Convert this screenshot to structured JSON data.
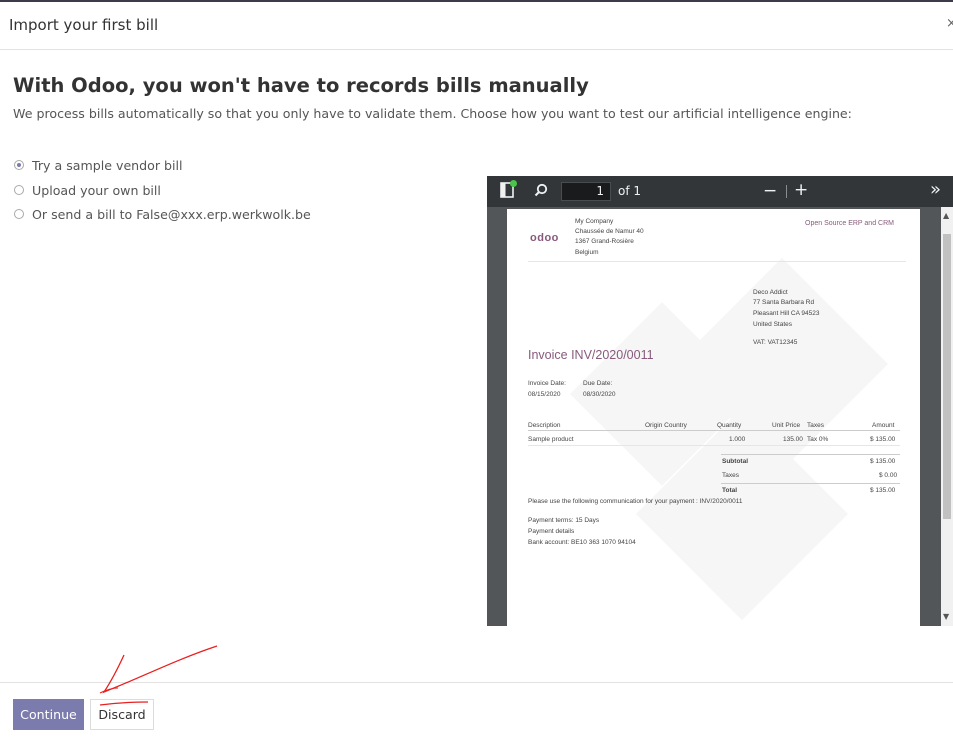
{
  "modal": {
    "title": "Import your first bill",
    "close": "×"
  },
  "main": {
    "heading": "With Odoo, you won't have to records bills manually",
    "subtitle": "We process bills automatically so that you only have to validate them. Choose how you want to test our artificial intelligence engine:"
  },
  "options": [
    {
      "label": "Try a sample vendor bill",
      "selected": true
    },
    {
      "label": "Upload your own bill",
      "selected": false
    },
    {
      "label": "Or send a bill to False@xxx.erp.werkwolk.be",
      "selected": false
    }
  ],
  "pdf_viewer": {
    "page_current": "1",
    "page_total": "of 1",
    "zoom_out": "−",
    "zoom_in": "+",
    "more": "»",
    "document": {
      "logo": "odoo",
      "tagline": "Open Source ERP and CRM",
      "company_lines": [
        "My Company",
        "Chaussée de Namur 40",
        "1367 Grand-Rosière",
        "Belgium"
      ],
      "partner_lines": [
        "Deco Addict",
        "77 Santa Barbara Rd",
        "Pleasant Hill CA 94523",
        "United States"
      ],
      "vat": "VAT: VAT12345",
      "invoice_title": "Invoice INV/2020/0011",
      "invoice_date_label": "Invoice Date:",
      "invoice_date": "08/15/2020",
      "due_date_label": "Due Date:",
      "due_date": "08/30/2020",
      "columns": [
        "Description",
        "Origin Country",
        "Quantity",
        "Unit Price",
        "Taxes",
        "Amount"
      ],
      "line": {
        "description": "Sample product",
        "quantity": "1.000",
        "unit_price": "135.00",
        "taxes": "Tax 0%",
        "amount": "$ 135.00"
      },
      "subtotal_label": "Subtotal",
      "subtotal": "$ 135.00",
      "taxes_label": "Taxes",
      "taxes": "$ 0.00",
      "total_label": "Total",
      "total": "$ 135.00",
      "communication": "Please use the following communication for your payment : INV/2020/0011",
      "payment_terms": "Payment terms: 15 Days",
      "payment_details": "Payment details",
      "bank_account": "Bank account: BE10 363 1070 94104"
    }
  },
  "footer": {
    "continue_label": "Continue",
    "discard_label": "Discard"
  },
  "colors": {
    "primary": "#7c7bad",
    "odoo_purple": "#875a7b",
    "annotation_red": "#e8201f"
  }
}
